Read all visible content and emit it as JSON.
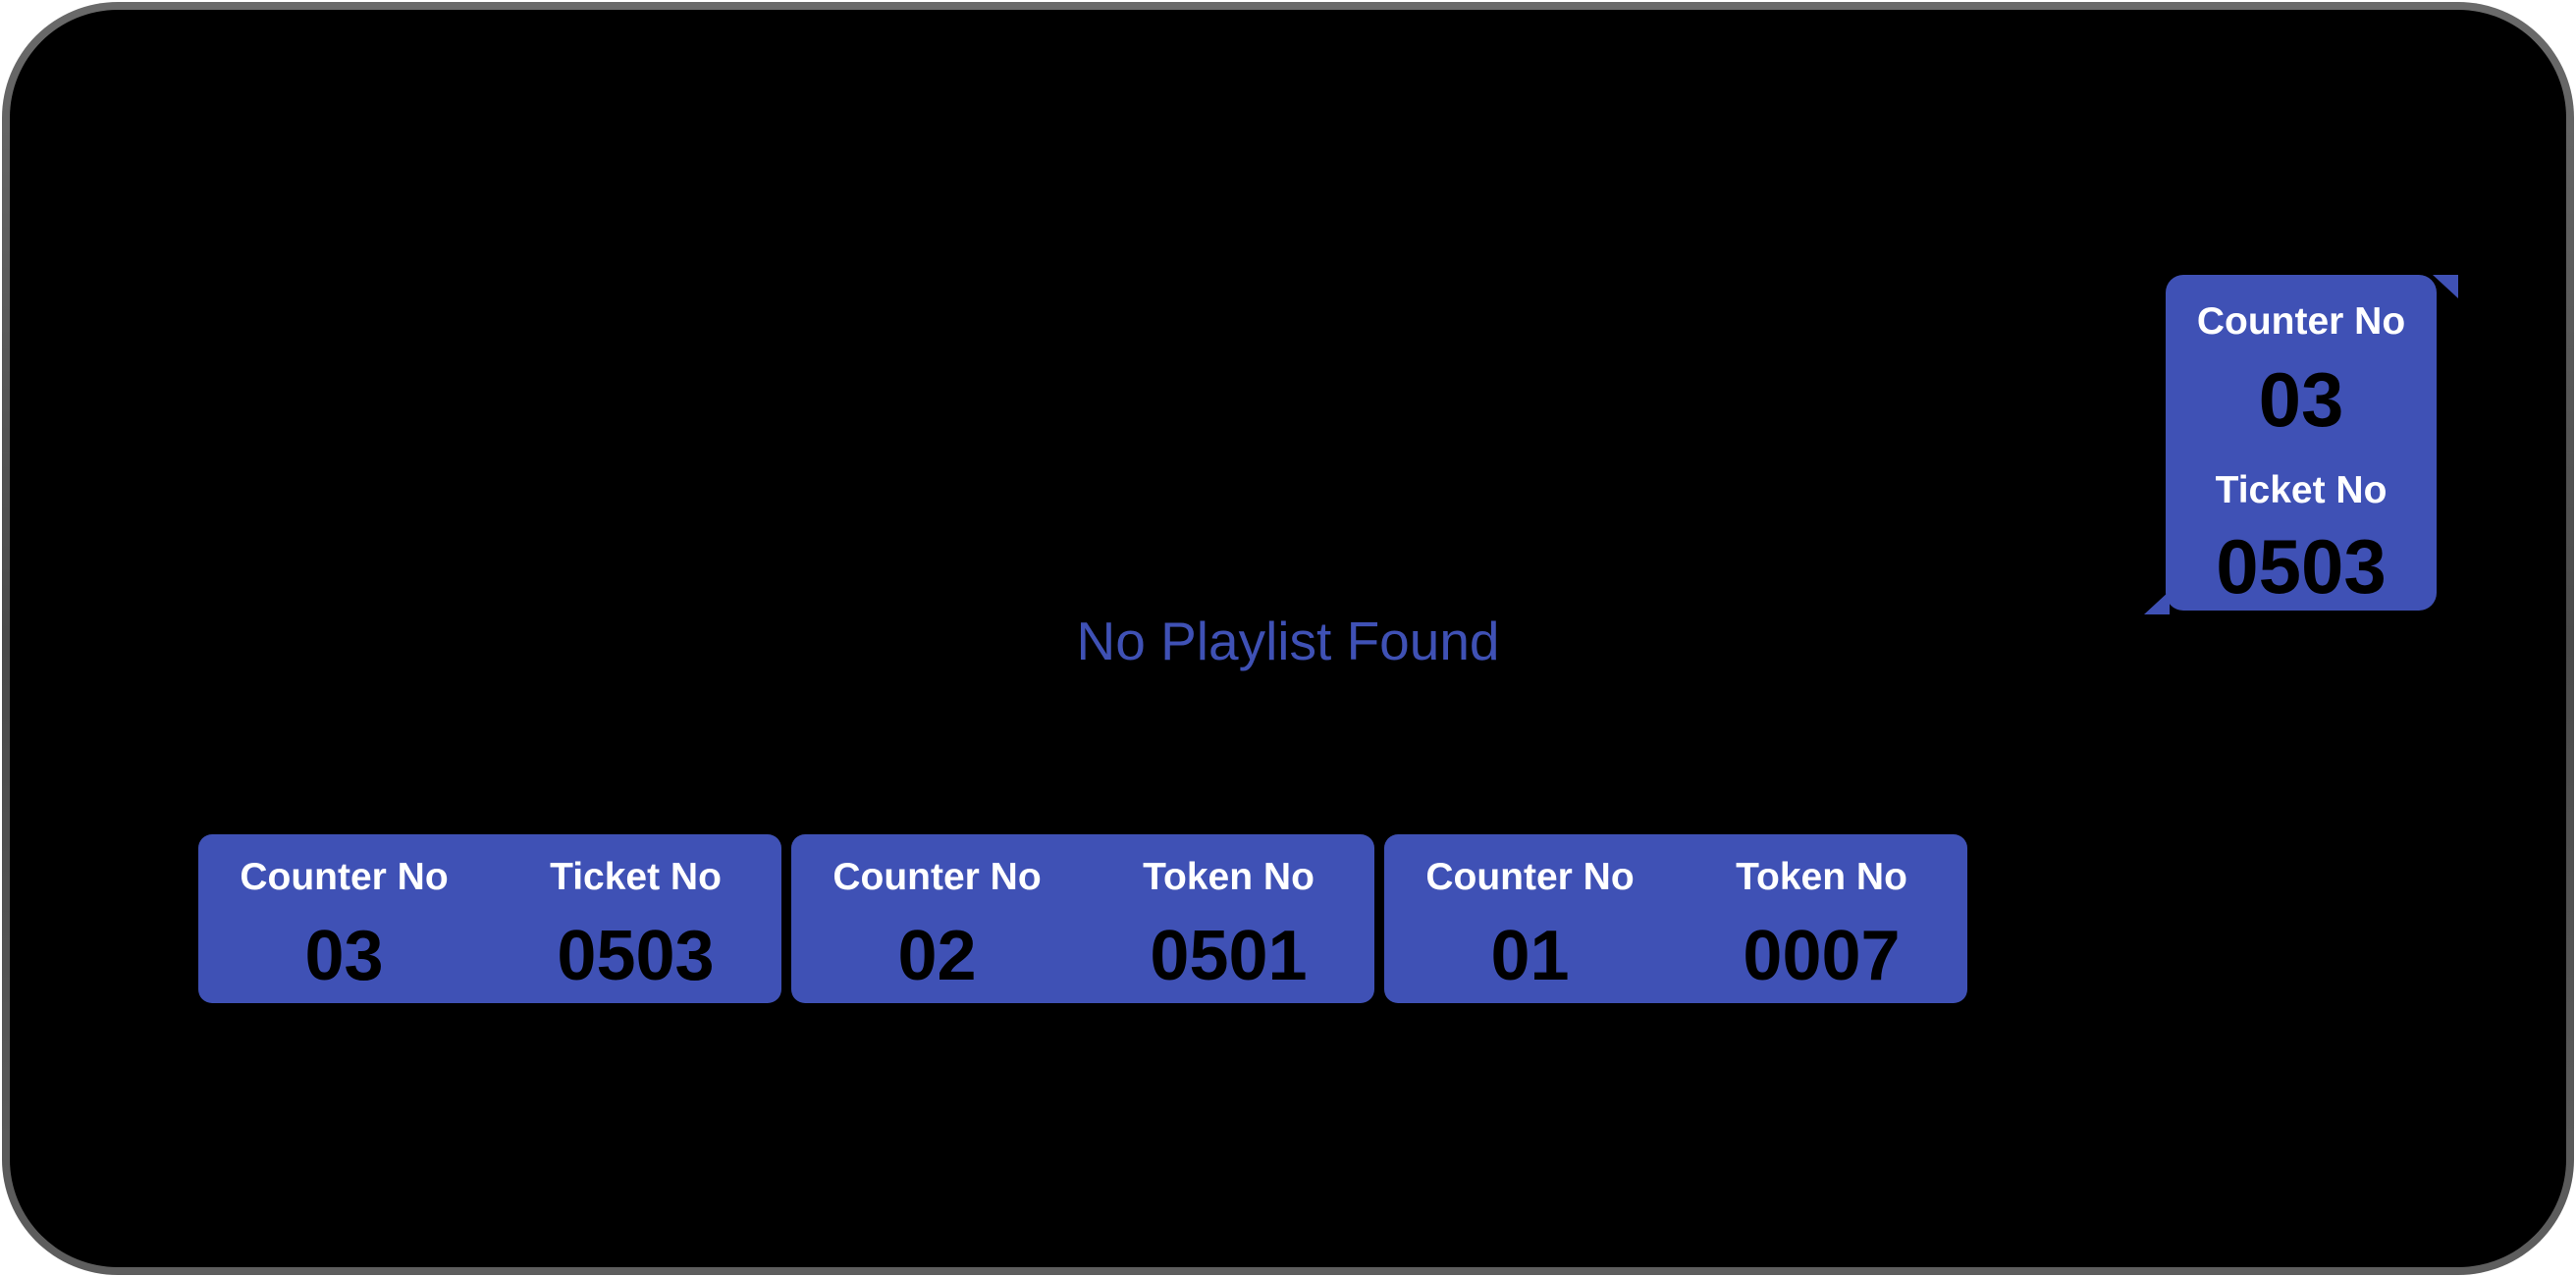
{
  "status_message": "No Playlist Found",
  "current_call": {
    "counter_label": "Counter No",
    "counter_value": "03",
    "ticket_label": "Ticket No",
    "ticket_value": "0503"
  },
  "history": [
    {
      "counter_label": "Counter No",
      "counter_value": "03",
      "number_label": "Ticket No",
      "number_value": "0503"
    },
    {
      "counter_label": "Counter No",
      "counter_value": "02",
      "number_label": "Token No",
      "number_value": "0501"
    },
    {
      "counter_label": "Counter No",
      "counter_value": "01",
      "number_label": "Token No",
      "number_value": "0007"
    }
  ],
  "colors": {
    "accent": "#3f51b5",
    "background": "#000000",
    "label_text": "#ffffff",
    "value_text": "#000000"
  }
}
